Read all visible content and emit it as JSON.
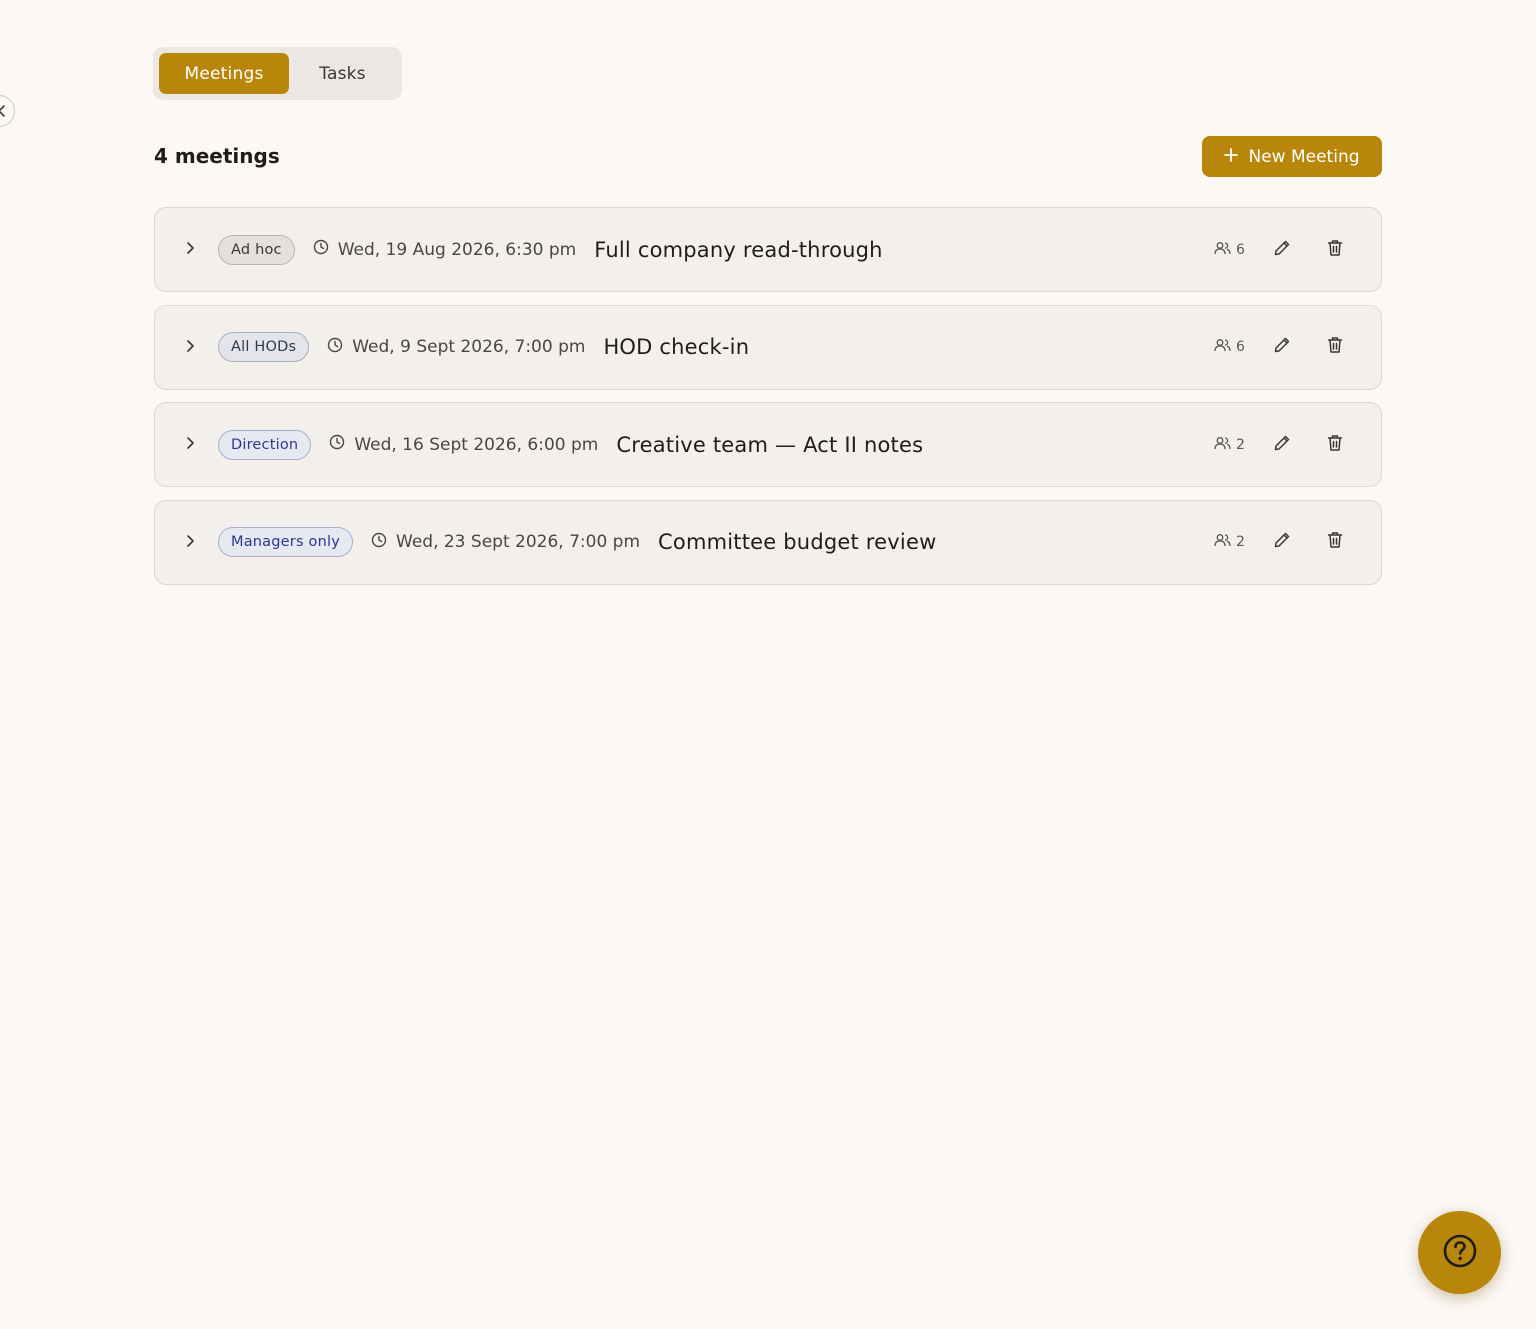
{
  "tabs": {
    "meetings_label": "Meetings",
    "tasks_label": "Tasks",
    "active": "Meetings"
  },
  "header": {
    "count_label": "4 meetings",
    "new_button_label": "New Meeting"
  },
  "meetings": [
    {
      "tag": "Ad hoc",
      "tag_style": "neutral",
      "datetime": "Wed, 19 Aug 2026, 6:30 pm",
      "title": "Full company read-through",
      "attendees": "6"
    },
    {
      "tag": "All HODs",
      "tag_style": "slate",
      "datetime": "Wed, 9 Sept 2026, 7:00 pm",
      "title": "HOD check-in",
      "attendees": "6"
    },
    {
      "tag": "Direction",
      "tag_style": "blue",
      "datetime": "Wed, 16 Sept 2026, 6:00 pm",
      "title": "Creative team — Act II notes",
      "attendees": "2"
    },
    {
      "tag": "Managers only",
      "tag_style": "blue",
      "datetime": "Wed, 23 Sept 2026, 7:00 pm",
      "title": "Committee budget review",
      "attendees": "2"
    }
  ],
  "colors": {
    "accent": "#b8860b",
    "background": "#fbf8f5",
    "row_background": "#f3f0eb"
  },
  "icons": {
    "sidebar_toggle": "chevron-left-icon",
    "new_button": "plus-icon",
    "row_expand": "chevron-right-icon",
    "time": "clock-icon",
    "attendees": "users-icon",
    "edit": "pencil-icon",
    "delete": "trash-icon",
    "help": "question-circle-icon"
  }
}
